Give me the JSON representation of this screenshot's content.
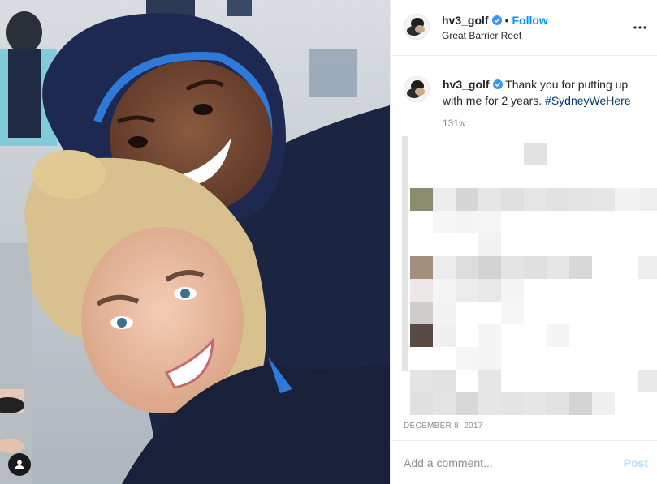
{
  "post": {
    "username": "hv3_golf",
    "follow_label": "Follow",
    "dot": "•",
    "location": "Great Barrier Reef",
    "verified_icon": "verified-badge-icon",
    "accent": "#0095f6",
    "hashtag_color": "#00376b"
  },
  "caption": {
    "username": "hv3_golf",
    "text": "Thank you for putting up with me for 2 years.",
    "hashtag": "#SydneyWeHere",
    "time_ago": "131w"
  },
  "date": "DECEMBER 8, 2017",
  "comment_box": {
    "placeholder": "Add a comment...",
    "post_label": "Post",
    "post_color": "#b2dffc"
  },
  "photo": {
    "tag_icon": "user-tag-icon",
    "description_icons": [
      "more-options-icon"
    ]
  }
}
